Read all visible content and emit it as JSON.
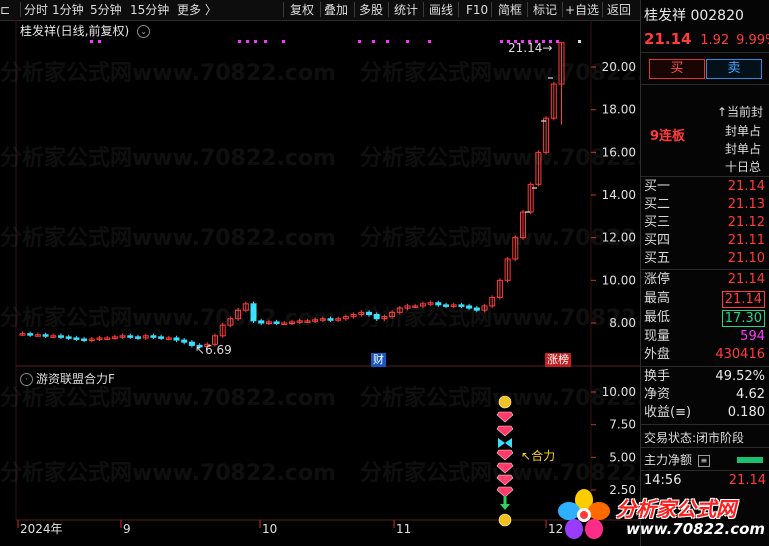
{
  "toolbar": {
    "left_items": [
      "分时",
      "1分钟",
      "5分钟",
      "15分钟",
      "更多 〉"
    ],
    "right_items": [
      "复权",
      "叠加",
      "多股",
      "统计",
      "画线",
      "F10",
      "简框",
      "标记",
      "+自选",
      "返回"
    ]
  },
  "chart_title": "桂发祥(日线,前复权)",
  "chart_title_icon": "chevron-down-icon",
  "price_axis": [
    "20.00",
    "18.00",
    "16.00",
    "14.00",
    "12.00",
    "10.00",
    "8.00"
  ],
  "max_label": "21.14",
  "min_label": "6.69",
  "event_markers": {
    "finance": "财",
    "limit_list": "涨榜"
  },
  "indicator": {
    "title": "游资联盟合力F",
    "axis": [
      "10.00",
      "7.50",
      "5.00",
      "2.50"
    ],
    "signal_label": "合力"
  },
  "date_axis": [
    "2024年",
    "9",
    "10",
    "11",
    "12"
  ],
  "watermark": "分析家公式网www.70822.com",
  "right_panel": {
    "name": "桂发祥",
    "code": "002820",
    "price": "21.14",
    "change": "1.92",
    "change_pct": "9.99%",
    "buy_label": "买",
    "sell_label": "卖",
    "streak": "9连板",
    "info_lines": [
      "↑当前封",
      "封单占",
      "封单占",
      "十日总"
    ],
    "order_book": [
      {
        "label": "买一",
        "value": "21.14"
      },
      {
        "label": "买二",
        "value": "21.13"
      },
      {
        "label": "买三",
        "value": "21.12"
      },
      {
        "label": "买四",
        "value": "21.11"
      },
      {
        "label": "买五",
        "value": "21.10"
      }
    ],
    "stats": [
      {
        "label": "涨停",
        "value": "21.14",
        "color": "red"
      },
      {
        "label": "最高",
        "value": "21.14",
        "color": "red"
      },
      {
        "label": "最低",
        "value": "17.30",
        "color": "green"
      },
      {
        "label": "现量",
        "value": "594",
        "color": "magenta"
      },
      {
        "label": "外盘",
        "value": "430416",
        "color": "red"
      }
    ],
    "stats2": [
      {
        "label": "换手",
        "value": "49.52%"
      },
      {
        "label": "净资",
        "value": "4.62"
      },
      {
        "label": "收益(≡)",
        "value": "0.180"
      }
    ],
    "trade_status_label": "交易状态:",
    "trade_status_value": "闭市阶段",
    "main_flow_label": "主力净额",
    "time": "14:56",
    "time_price": "21.14"
  },
  "logo": {
    "site_name": "分析家公式网",
    "url": "www.70822.com"
  },
  "colors": {
    "up": "#ff3b3b",
    "down": "#37e0ff",
    "signal": "#ff33ff",
    "accent_red": "#e02020"
  }
}
